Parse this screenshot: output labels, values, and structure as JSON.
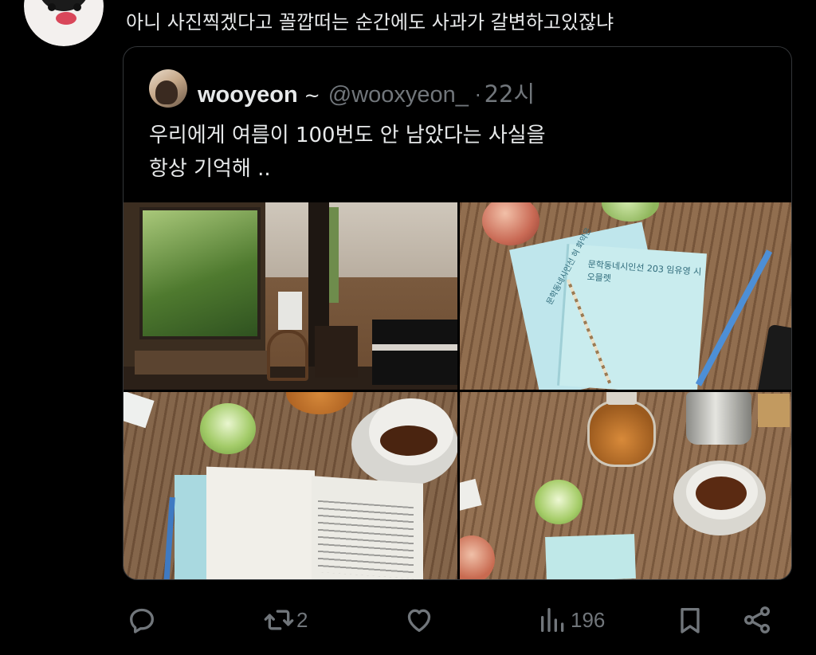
{
  "reply": {
    "text": "아니 사진찍겠다고 꼴깝떠는 순간에도 사과가 갈변하고있잖냐"
  },
  "quoted": {
    "display_name": "wooyeon",
    "name_suffix": "~",
    "handle": "@wooxyeon_",
    "separator": "·",
    "time": "22시",
    "text_line1": "우리에게 여름이 100번도 안 남았다는 사실을",
    "text_line2": "항상 기억해 ..",
    "photo_text": {
      "book_title": "문학동네시인선 203 임유영 시",
      "book_subtitle": "오믈렛",
      "book_title2": "문학동네시인선 혀 화약은"
    }
  },
  "actions": {
    "reply_icon": "reply-icon",
    "retweet_icon": "retweet-icon",
    "retweet_count": "2",
    "like_icon": "like-icon",
    "views_icon": "views-icon",
    "views_count": "196",
    "bookmark_icon": "bookmark-icon",
    "share_icon": "share-icon"
  },
  "colors": {
    "background": "#000000",
    "text": "#e7e9ea",
    "muted": "#71767b",
    "border": "#333639"
  }
}
